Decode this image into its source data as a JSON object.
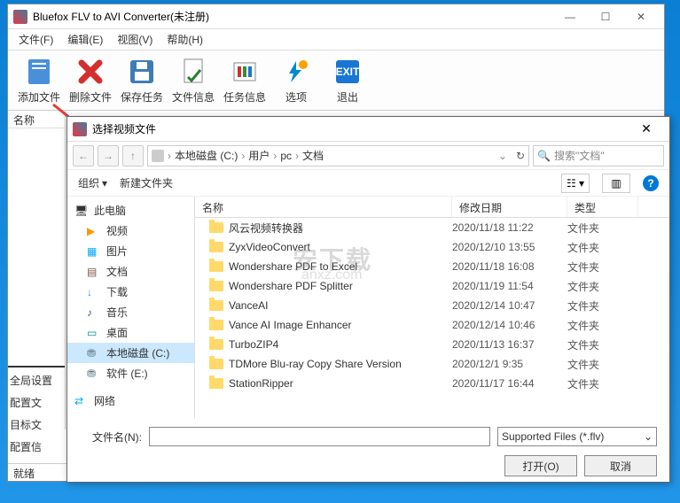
{
  "main": {
    "title": "Bluefox FLV to AVI Converter(未注册)",
    "menu": {
      "file": "文件(F)",
      "edit": "编辑(E)",
      "view": "视图(V)",
      "help": "帮助(H)"
    },
    "toolbar": {
      "add_file": "添加文件",
      "delete_file": "删除文件",
      "save_task": "保存任务",
      "file_info": "文件信息",
      "task_info": "任务信息",
      "options": "选项",
      "exit": "退出"
    },
    "list_header": "名称",
    "side_tabs": {
      "global": "全局设置",
      "config_a": "配置文",
      "target": "目标文",
      "config_b": "配置信"
    },
    "status": "就绪"
  },
  "dialog": {
    "title": "选择视频文件",
    "breadcrumb": {
      "p0": "本地磁盘 (C:)",
      "p1": "用户",
      "p2": "pc",
      "p3": "文档"
    },
    "search_placeholder": "搜索\"文档\"",
    "toolbar": {
      "organize": "组织",
      "new_folder": "新建文件夹"
    },
    "sidebar": {
      "this_pc": "此电脑",
      "videos": "视频",
      "pictures": "图片",
      "documents": "文档",
      "downloads": "下载",
      "music": "音乐",
      "desktop": "桌面",
      "local_c": "本地磁盘 (C:)",
      "software_e": "软件 (E:)",
      "network": "网络"
    },
    "cols": {
      "name": "名称",
      "date": "修改日期",
      "type": "类型"
    },
    "files": [
      {
        "name": "风云视频转换器",
        "date": "2020/11/18 11:22",
        "type": "文件夹"
      },
      {
        "name": "ZyxVideoConvert",
        "date": "2020/12/10 13:55",
        "type": "文件夹"
      },
      {
        "name": "Wondershare PDF to Excel",
        "date": "2020/11/18 16:08",
        "type": "文件夹"
      },
      {
        "name": "Wondershare PDF Splitter",
        "date": "2020/11/19 11:54",
        "type": "文件夹"
      },
      {
        "name": "VanceAI",
        "date": "2020/12/14 10:47",
        "type": "文件夹"
      },
      {
        "name": "Vance AI Image Enhancer",
        "date": "2020/12/14 10:46",
        "type": "文件夹"
      },
      {
        "name": "TurboZIP4",
        "date": "2020/11/13 16:37",
        "type": "文件夹"
      },
      {
        "name": "TDMore Blu-ray Copy Share Version",
        "date": "2020/12/1 9:35",
        "type": "文件夹"
      },
      {
        "name": "StationRipper",
        "date": "2020/11/17 16:44",
        "type": "文件夹"
      }
    ],
    "footer": {
      "filename_label": "文件名(N):",
      "filter": "Supported Files (*.flv)",
      "open": "打开(O)",
      "cancel": "取消"
    }
  }
}
